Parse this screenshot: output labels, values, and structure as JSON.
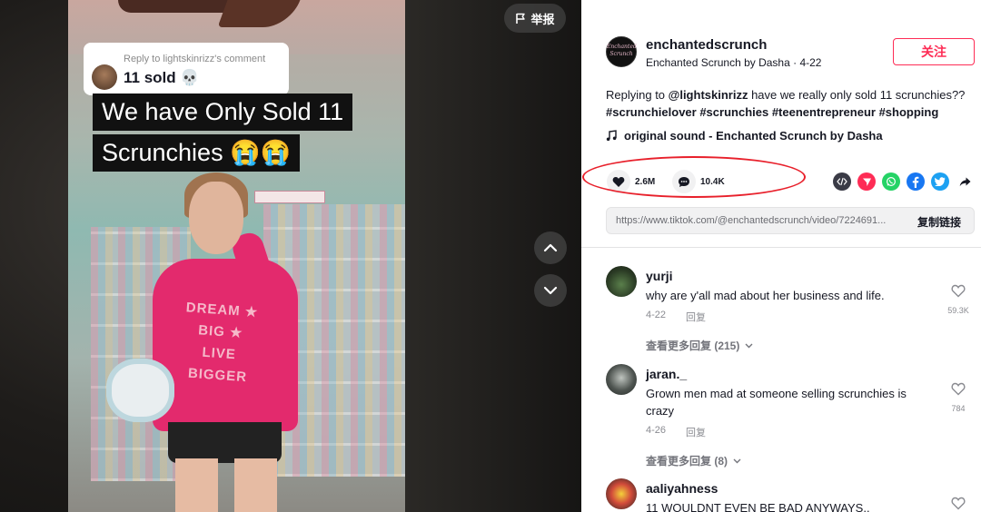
{
  "video": {
    "reply_to": "Reply to lightskinrizz's comment",
    "reply_text": "11 sold 💀",
    "caption_line_1": "We have Only Sold 11",
    "caption_line_2": "Scrunchies 😭😭",
    "report_label": "举报",
    "sweatshirt_text": "DREAM ★ BIG ★ LIVE BIGGER"
  },
  "author": {
    "handle": "enchantedscrunch",
    "display_name": "Enchanted Scrunch by Dasha",
    "date": "4-22",
    "avatar_text": "Enchanted Scrunch",
    "follow_label": "关注"
  },
  "description": {
    "prefix": "Replying to ",
    "mention": "@lightskinrizz",
    "text": " have we really only sold 11 scrunchies?? ",
    "hashtags": "#scrunchielover #scrunchies #teenentrepreneur #shopping"
  },
  "music": {
    "label": "original sound - Enchanted Scrunch by Dasha"
  },
  "stats": {
    "likes": "2.6M",
    "comments": "10.4K"
  },
  "share": {
    "url": "https://www.tiktok.com/@enchantedscrunch/video/7224691...",
    "copy_label": "复制链接"
  },
  "comments": [
    {
      "user": "yurji",
      "text": "why are y'all mad about her business and life.",
      "date": "4-22",
      "reply_label": "回复",
      "likes": "59.3K",
      "more_replies": "查看更多回复 (215)"
    },
    {
      "user": "jaran._",
      "text": "Grown men mad at someone selling scrunchies is crazy",
      "date": "4-26",
      "reply_label": "回复",
      "likes": "784",
      "more_replies": "查看更多回复 (8)"
    },
    {
      "user": "aaliyahness",
      "text": "11 WOULDNT EVEN BE BAD ANYWAYS.."
    }
  ],
  "colors": {
    "brand_red": "#fe2c55",
    "annotation_red": "#e8202b",
    "text_primary": "#161823",
    "text_secondary": "#8a8b91"
  }
}
